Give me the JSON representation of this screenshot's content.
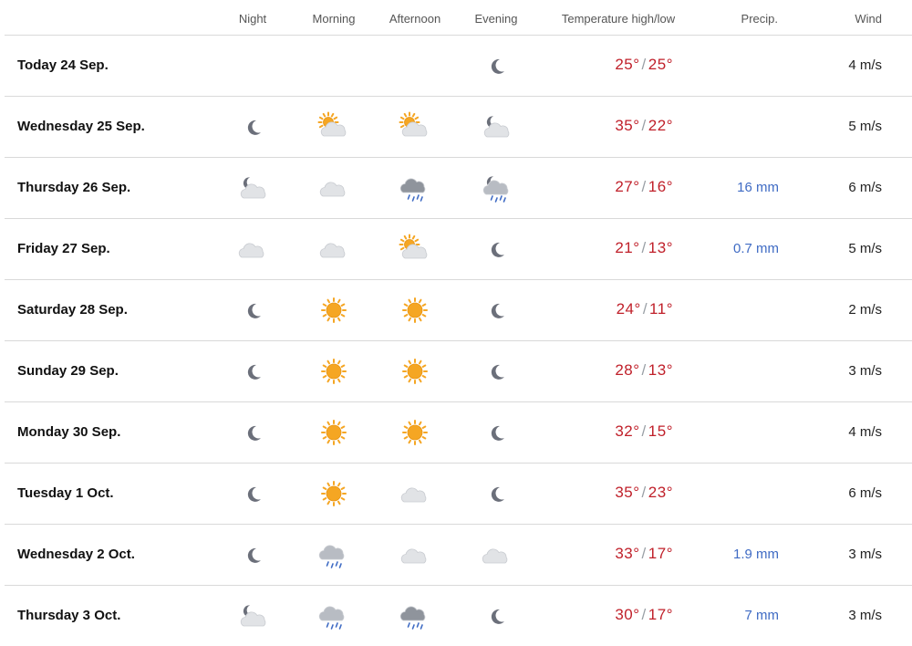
{
  "header": {
    "night": "Night",
    "morning": "Morning",
    "afternoon": "Afternoon",
    "evening": "Evening",
    "temperature": "Temperature high/low",
    "precip": "Precip.",
    "wind": "Wind"
  },
  "temp_separator": "/",
  "rows": [
    {
      "day": "Today 24 Sep.",
      "icons": [
        "",
        "",
        "",
        "moon"
      ],
      "high": "25°",
      "low": "25°",
      "precip": "",
      "wind": "4 m/s"
    },
    {
      "day": "Wednesday 25 Sep.",
      "icons": [
        "moon",
        "sun-cloud",
        "sun-cloud",
        "moon-cloud"
      ],
      "high": "35°",
      "low": "22°",
      "precip": "",
      "wind": "5 m/s"
    },
    {
      "day": "Thursday 26 Sep.",
      "icons": [
        "moon-cloud",
        "cloud",
        "rain-cloud-dark",
        "moon-rain-cloud"
      ],
      "high": "27°",
      "low": "16°",
      "precip": "16 mm",
      "wind": "6 m/s"
    },
    {
      "day": "Friday 27 Sep.",
      "icons": [
        "cloud",
        "cloud",
        "sun-cloud",
        "moon"
      ],
      "high": "21°",
      "low": "13°",
      "precip": "0.7 mm",
      "wind": "5 m/s"
    },
    {
      "day": "Saturday 28 Sep.",
      "icons": [
        "moon",
        "sun",
        "sun",
        "moon"
      ],
      "high": "24°",
      "low": "11°",
      "precip": "",
      "wind": "2 m/s"
    },
    {
      "day": "Sunday 29 Sep.",
      "icons": [
        "moon",
        "sun",
        "sun",
        "moon"
      ],
      "high": "28°",
      "low": "13°",
      "precip": "",
      "wind": "3 m/s"
    },
    {
      "day": "Monday 30 Sep.",
      "icons": [
        "moon",
        "sun",
        "sun",
        "moon"
      ],
      "high": "32°",
      "low": "15°",
      "precip": "",
      "wind": "4 m/s"
    },
    {
      "day": "Tuesday 1 Oct.",
      "icons": [
        "moon",
        "sun",
        "cloud",
        "moon"
      ],
      "high": "35°",
      "low": "23°",
      "precip": "",
      "wind": "6 m/s"
    },
    {
      "day": "Wednesday 2 Oct.",
      "icons": [
        "moon",
        "rain-cloud",
        "cloud",
        "cloud"
      ],
      "high": "33°",
      "low": "17°",
      "precip": "1.9 mm",
      "wind": "3 m/s"
    },
    {
      "day": "Thursday 3 Oct.",
      "icons": [
        "moon-cloud",
        "rain-cloud",
        "rain-cloud-dark",
        "moon"
      ],
      "high": "30°",
      "low": "17°",
      "precip": "7 mm",
      "wind": "3 m/s"
    }
  ],
  "colors": {
    "temperature": "#c0202a",
    "precipitation": "#3f6bc4",
    "moon": "#6b6f7a",
    "sun": "#f5a623",
    "cloud": "#e1e3e6",
    "rain": "#3f6bc4"
  }
}
